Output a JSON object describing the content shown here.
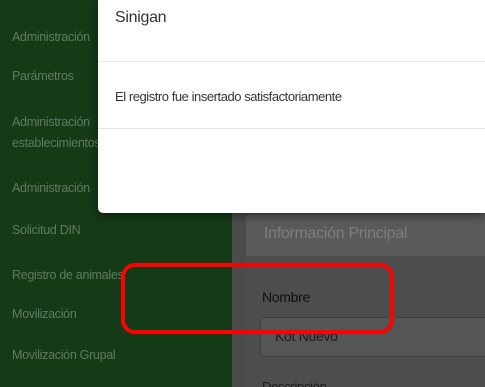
{
  "sidebar": {
    "items": [
      {
        "label": "Administración"
      },
      {
        "label": "Parámetros"
      },
      {
        "label": "Administración"
      },
      {
        "label": "establecimientos"
      },
      {
        "label": "Administración"
      },
      {
        "label": "Solicitud DIN"
      },
      {
        "label": "Registro de animales"
      },
      {
        "label": "Movilización"
      },
      {
        "label": "Movilización Grupal"
      }
    ]
  },
  "main": {
    "panel_title": "Información Principal",
    "name_label": "Nombre",
    "name_value": "Kot Nuevo",
    "next_label": "Descripción"
  },
  "modal": {
    "title": "Sinigan",
    "message": "El registro fue insertado satisfactoriamente"
  },
  "colors": {
    "sidebar_bg": "#143a16",
    "highlight": "#ff0000",
    "modal_bg": "#ffffff"
  }
}
